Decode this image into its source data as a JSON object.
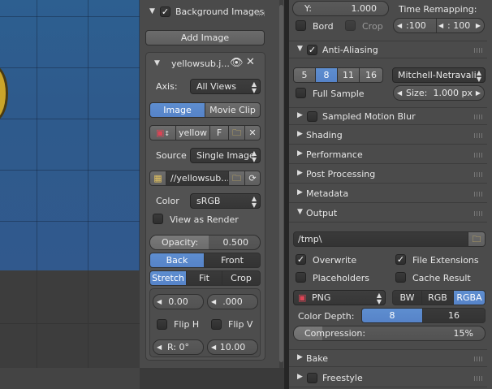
{
  "n_panel": {
    "background_images": {
      "title": "Background Images",
      "add_image": "Add Image",
      "image_name": "yellowsub.j...",
      "axis_label": "Axis:",
      "axis_value": "All Views",
      "source_tabs": [
        "Image",
        "Movie Clip"
      ],
      "datablock_name": "yellow",
      "fake_user": "F",
      "source_label": "Source",
      "source_value": "Single Image",
      "filepath": "//yellowsub...",
      "color_label": "Color",
      "color_value": "sRGB",
      "view_as_render": "View as Render",
      "opacity_label": "Opacity:",
      "opacity_value": "0.500",
      "front_back": [
        "Back",
        "Front"
      ],
      "fit_modes": [
        "Stretch",
        "Fit",
        "Crop"
      ],
      "offset_x": "0.00",
      "offset_y": ".000",
      "flip_h": "Flip H",
      "flip_v": "Flip V",
      "rotation": "R: 0°",
      "size": "10.00"
    }
  },
  "render": {
    "top": {
      "y_label": "Y:",
      "y_value": "1.000",
      "time_remapping": "Time Remapping:",
      "bord": "Bord",
      "crop": "Crop",
      "remap_old": ":100",
      "remap_new": ": 100"
    },
    "anti_aliasing": {
      "title": "Anti-Aliasing",
      "samples": [
        "5",
        "8",
        "11",
        "16"
      ],
      "selected_sample": "8",
      "filter": "Mitchell-Netravali",
      "full_sample": "Full Sample",
      "size_label": "Size:",
      "size_value": "1.000 px"
    },
    "panels": [
      "Sampled Motion Blur",
      "Shading",
      "Performance",
      "Post Processing",
      "Metadata"
    ],
    "output": {
      "title": "Output",
      "path": "/tmp\\",
      "overwrite": "Overwrite",
      "file_extensions": "File Extensions",
      "placeholders": "Placeholders",
      "cache_result": "Cache Result",
      "format": "PNG",
      "color_modes": [
        "BW",
        "RGB",
        "RGBA"
      ],
      "selected_color_mode": "RGBA",
      "color_depth_label": "Color Depth:",
      "color_depths": [
        "8",
        "16"
      ],
      "selected_depth": "8",
      "compression_label": "Compression:",
      "compression_value": "15%",
      "compression_fraction": 0.15
    },
    "bottom_panels": [
      "Bake",
      "Freestyle"
    ]
  },
  "colors": {
    "accent": "#5683c8",
    "panel": "#4a4a4a",
    "viewport_bg": "#2e5a8c"
  }
}
